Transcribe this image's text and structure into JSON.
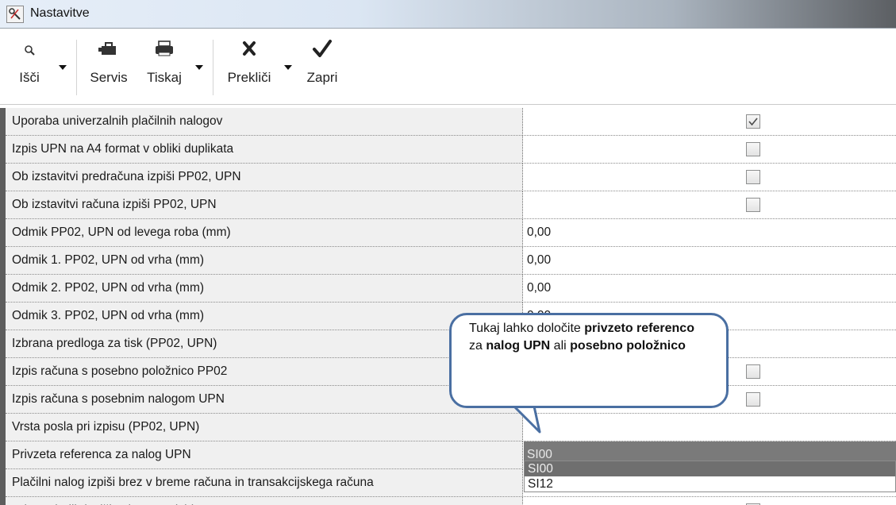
{
  "window": {
    "title": "Nastavitve"
  },
  "toolbar": {
    "items": [
      {
        "label": "Išči",
        "icon": "search-icon",
        "has_dropdown": true
      },
      {
        "label": "Servis",
        "icon": "toolbox-icon",
        "has_dropdown": false
      },
      {
        "label": "Tiskaj",
        "icon": "printer-icon",
        "has_dropdown": true
      },
      {
        "label": "Prekliči",
        "icon": "cross-icon",
        "has_dropdown": true
      },
      {
        "label": "Zapri",
        "icon": "checkmark-icon",
        "has_dropdown": false
      }
    ]
  },
  "settings": {
    "rows": [
      {
        "label": "Uporaba univerzalnih plačilnih nalogov",
        "type": "checkbox",
        "checked": true
      },
      {
        "label": "Izpis UPN na A4 format v obliki duplikata",
        "type": "checkbox",
        "checked": false
      },
      {
        "label": "Ob izstavitvi predračuna izpiši PP02, UPN",
        "type": "checkbox",
        "checked": false
      },
      {
        "label": "Ob izstavitvi računa izpiši PP02, UPN",
        "type": "checkbox",
        "checked": false
      },
      {
        "label": "Odmik PP02, UPN od levega roba (mm)",
        "type": "text",
        "value": "0,00"
      },
      {
        "label": "Odmik 1. PP02, UPN od vrha (mm)",
        "type": "text",
        "value": "0,00"
      },
      {
        "label": "Odmik 2. PP02, UPN od vrha (mm)",
        "type": "text",
        "value": "0,00"
      },
      {
        "label": "Odmik 3. PP02, UPN od vrha (mm)",
        "type": "text",
        "value": "0,00"
      },
      {
        "label": "Izbrana predloga za tisk (PP02, UPN)",
        "type": "text",
        "value": ""
      },
      {
        "label": "Izpis računa s posebno položnico PP02",
        "type": "checkbox",
        "checked": false
      },
      {
        "label": "Izpis računa s posebnim nalogom UPN",
        "type": "checkbox",
        "checked": false
      },
      {
        "label": "Vrsta posla pri izpisu (PP02, UPN)",
        "type": "text",
        "value": ""
      },
      {
        "label": "Privzeta referenca za nalog UPN",
        "type": "text",
        "value": "SI00",
        "selected": true
      },
      {
        "label": "Plačilni nalog izpiši brez v breme računa in transakcijskega računa",
        "type": "text",
        "value": ""
      },
      {
        "label": "Pri pregledih izpiši zahtevano izbiro",
        "type": "checkbox",
        "checked": true
      }
    ]
  },
  "dropdown": {
    "options": [
      "SI00",
      "SI12"
    ],
    "selected": "SI00"
  },
  "callout": {
    "part1": "Tukaj lahko določite ",
    "part2": "privzeto referenco",
    "part3": "za ",
    "part4": "nalog UPN",
    "part5": " ali ",
    "part6": "posebno položnico"
  },
  "colors": {
    "selection": "#7a7a7a",
    "label_bg": "#f0f0f0",
    "callout_border": "#4a6fa2"
  }
}
